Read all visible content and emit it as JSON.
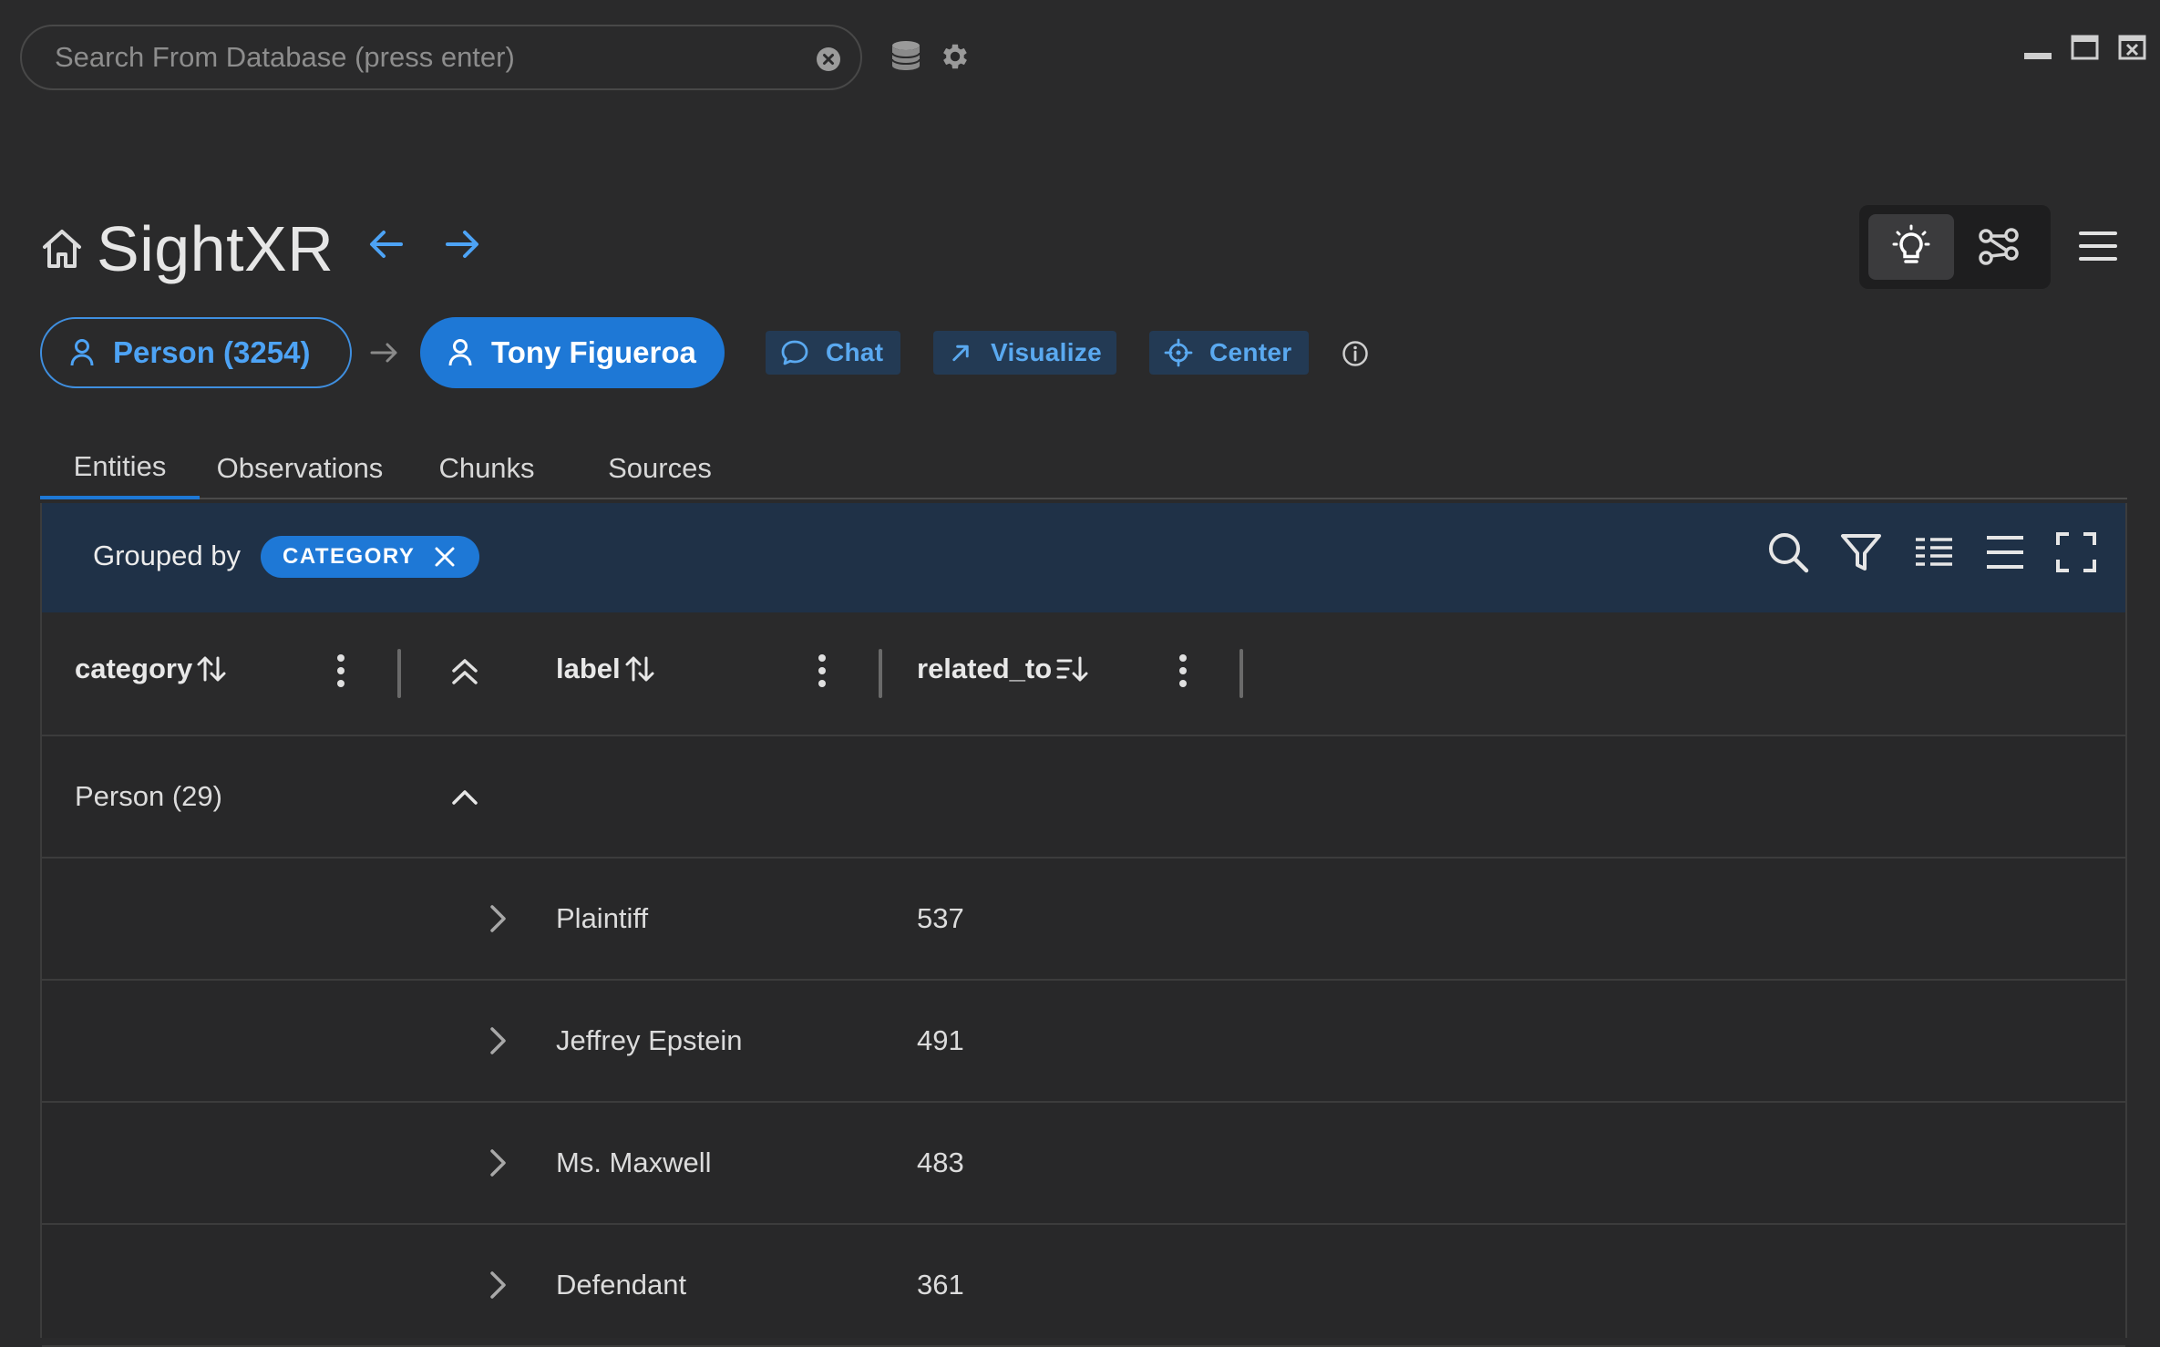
{
  "search": {
    "placeholder": "Search From Database (press enter)",
    "value": ""
  },
  "icons": {
    "clear": "close-circle-icon",
    "database": "database-icon",
    "settings": "gear-icon",
    "minimize": "minimize-icon",
    "maximize": "maximize-icon",
    "close": "close-window-icon",
    "home": "home-icon",
    "back": "arrow-left-icon",
    "forward": "arrow-right-icon",
    "light_mode": "lightbulb-icon",
    "graph_mode": "graph-nodes-icon",
    "menu": "hamburger-menu-icon"
  },
  "app": {
    "title": "SightXR"
  },
  "breadcrumb": {
    "type_chip": "Person (3254)",
    "entity_chip": "Tony Figueroa"
  },
  "actions": {
    "chat": "Chat",
    "visualize": "Visualize",
    "center": "Center"
  },
  "tabs": [
    {
      "label": "Entities",
      "active": true
    },
    {
      "label": "Observations",
      "active": false
    },
    {
      "label": "Chunks",
      "active": false
    },
    {
      "label": "Sources",
      "active": false
    }
  ],
  "grid": {
    "grouped_by_label": "Grouped by",
    "group_chip": "CATEGORY",
    "columns": {
      "category": "category",
      "label": "label",
      "related_to": "related_to"
    },
    "group_row": {
      "label": "Person (29)"
    },
    "rows": [
      {
        "label": "Plaintiff",
        "related_to": "537"
      },
      {
        "label": "Jeffrey Epstein",
        "related_to": "491"
      },
      {
        "label": "Ms. Maxwell",
        "related_to": "483"
      },
      {
        "label": "Defendant",
        "related_to": "361"
      }
    ]
  },
  "colors": {
    "background": "#2a2a2b",
    "accent": "#1e78d6",
    "accent_text": "#4da3f5",
    "toolbar": "#1f3147"
  }
}
